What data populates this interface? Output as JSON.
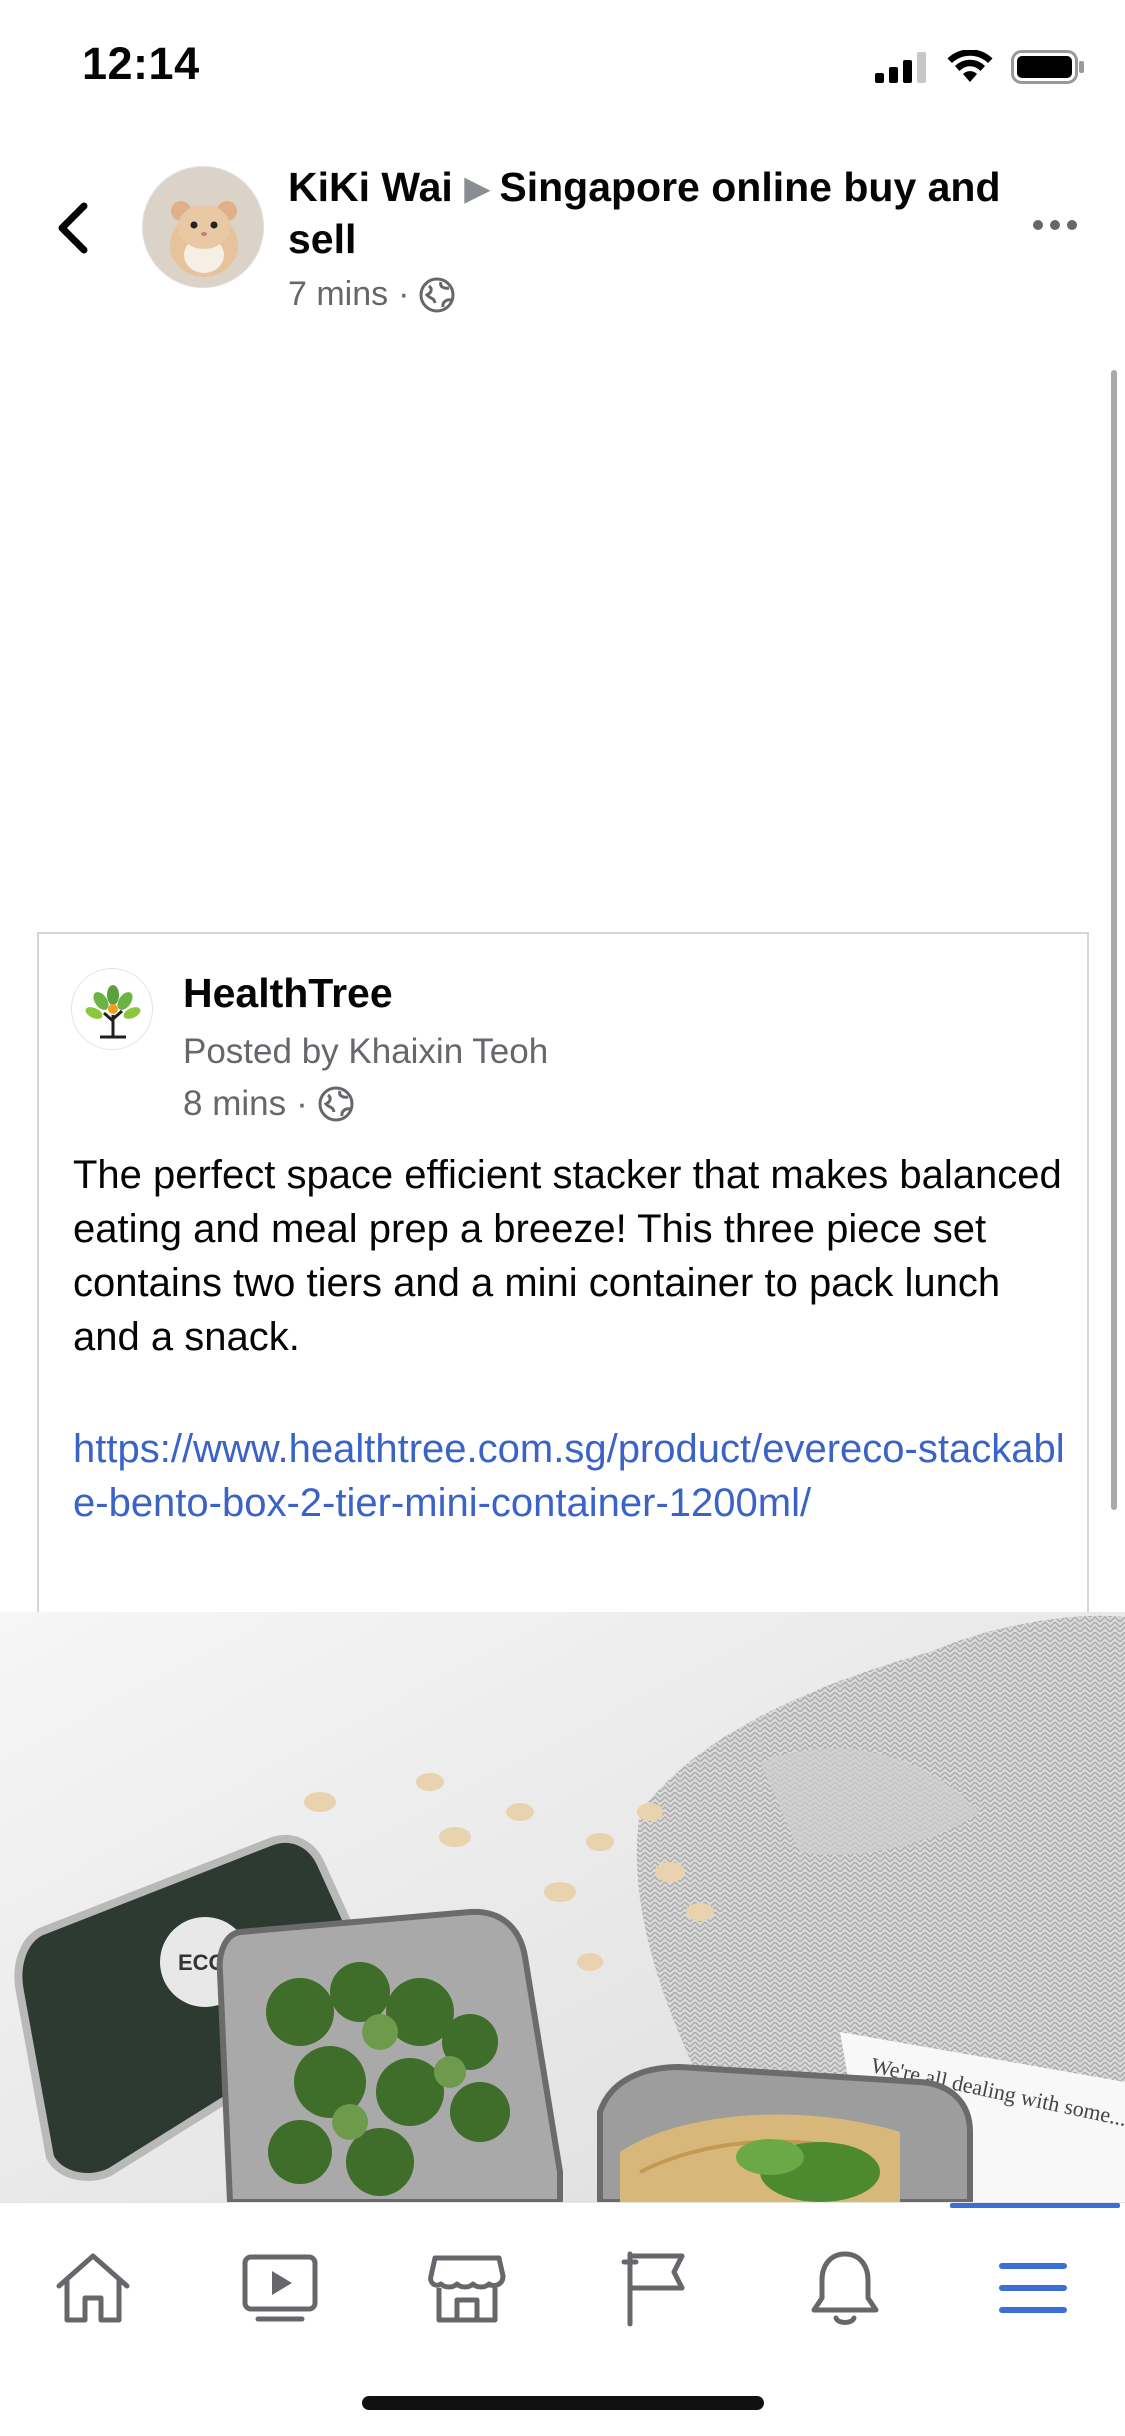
{
  "status_bar": {
    "time": "12:14"
  },
  "header": {
    "author": "KiKi Wai",
    "group": "Singapore online buy and sell",
    "time_ago": "7 mins",
    "privacy_icon": "globe-icon"
  },
  "shared_post": {
    "page_name": "HealthTree",
    "posted_by": "Posted by Khaixin Teoh",
    "time_ago": "8 mins",
    "privacy_icon": "globe-icon",
    "text": "The perfect space efficient stacker that makes balanced eating and meal prep a breeze! This three piece set contains two tiers and a mini container to pack lunch and a snack.",
    "link": "https://www.healthtree.com.sg/product/evereco-stackable-bento-box-2-tier-mini-container-1200ml/",
    "image_text": "We're all dealing with some... Perfection is an illusion at... uncertainty is a certainty",
    "link_color": "#3a63c8"
  },
  "tab_bar": {
    "active_index": 5,
    "active_color": "#3a6fd8",
    "tabs": [
      {
        "icon": "home-icon"
      },
      {
        "icon": "video-icon"
      },
      {
        "icon": "marketplace-icon"
      },
      {
        "icon": "pages-flag-icon"
      },
      {
        "icon": "notifications-bell-icon"
      },
      {
        "icon": "menu-icon"
      }
    ]
  }
}
